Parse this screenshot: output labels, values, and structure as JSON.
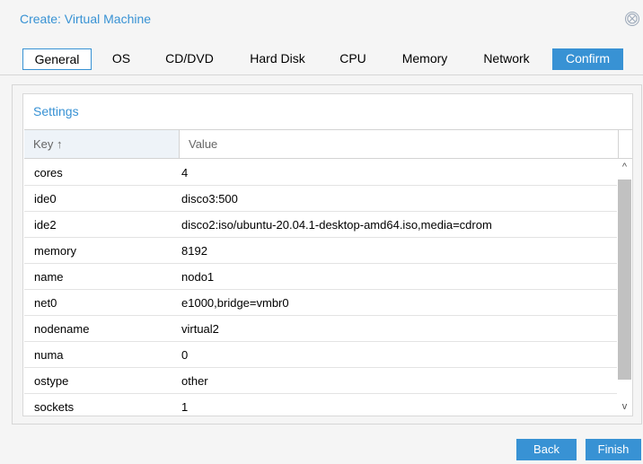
{
  "dialog": {
    "title": "Create: Virtual Machine",
    "close_icon": "⨂"
  },
  "tabs": [
    {
      "label": "General"
    },
    {
      "label": "OS"
    },
    {
      "label": "CD/DVD"
    },
    {
      "label": "Hard Disk"
    },
    {
      "label": "CPU"
    },
    {
      "label": "Memory"
    },
    {
      "label": "Network"
    },
    {
      "label": "Confirm"
    }
  ],
  "settings": {
    "title": "Settings",
    "columns": {
      "key": "Key ↑",
      "value": "Value"
    },
    "rows": [
      {
        "key": "cores",
        "value": "4"
      },
      {
        "key": "ide0",
        "value": "disco3:500"
      },
      {
        "key": "ide2",
        "value": "disco2:iso/ubuntu-20.04.1-desktop-amd64.iso,media=cdrom"
      },
      {
        "key": "memory",
        "value": "8192"
      },
      {
        "key": "name",
        "value": "nodo1"
      },
      {
        "key": "net0",
        "value": "e1000,bridge=vmbr0"
      },
      {
        "key": "nodename",
        "value": "virtual2"
      },
      {
        "key": "numa",
        "value": "0"
      },
      {
        "key": "ostype",
        "value": "other"
      },
      {
        "key": "sockets",
        "value": "1"
      }
    ],
    "scroll_up_glyph": "^",
    "scroll_down_glyph": "v"
  },
  "footer": {
    "back_label": "Back",
    "finish_label": "Finish"
  },
  "colors": {
    "accent": "#3892d4",
    "background": "#f5f5f5"
  }
}
